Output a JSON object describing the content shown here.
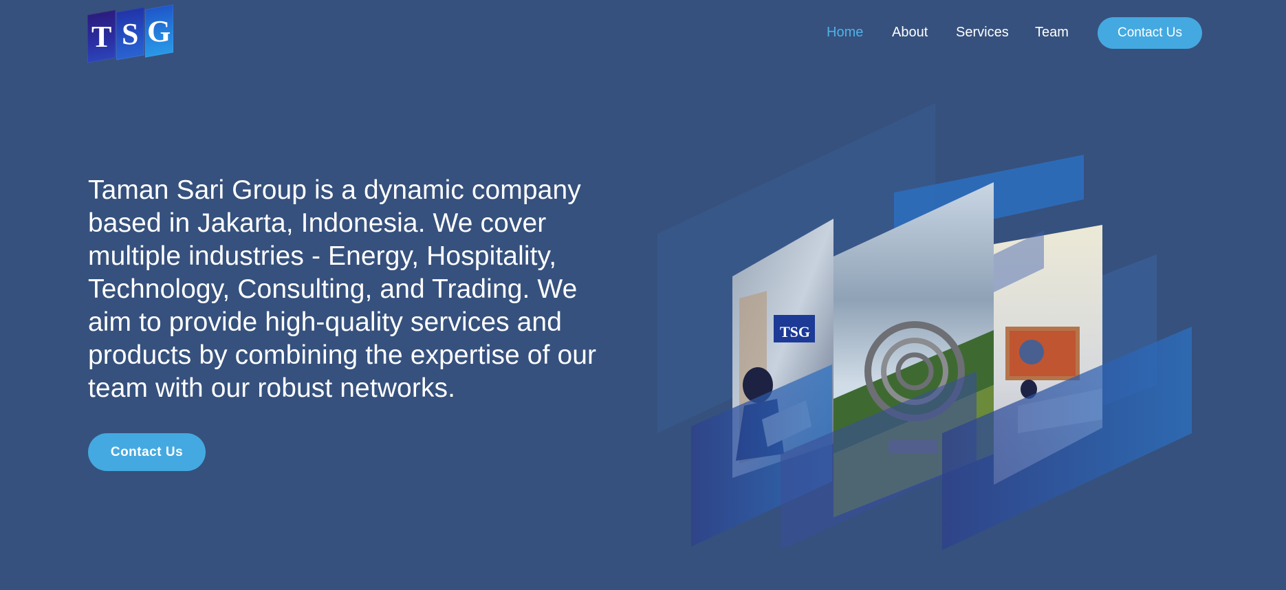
{
  "brand": {
    "logo_letters": [
      "T",
      "S",
      "G"
    ],
    "logo_colors": [
      "#2b1c7e",
      "#2552c6",
      "#2a98e6"
    ]
  },
  "nav": {
    "items": [
      {
        "label": "Home",
        "active": true
      },
      {
        "label": "About",
        "active": false
      },
      {
        "label": "Services",
        "active": false
      },
      {
        "label": "Team",
        "active": false
      }
    ],
    "contact_label": "Contact Us"
  },
  "hero": {
    "lines": [
      "Taman Sari Group is a dynamic company",
      "based in Jakarta, Indonesia. We cover",
      "multiple industries - Energy, Hospitality,",
      "Technology, Consulting, and Trading. We",
      "aim to provide high-quality services and",
      "products by combining the expertise of our",
      "team with our robust networks."
    ],
    "cta_label": "Contact Us"
  },
  "collage": {
    "photos": [
      "office-photo",
      "sculpture-photo",
      "meeting-room-photo"
    ],
    "sign_text": "TSG"
  },
  "colors": {
    "background": "#36517d",
    "accent": "#44a9e0",
    "active_link": "#4fb2ea"
  }
}
